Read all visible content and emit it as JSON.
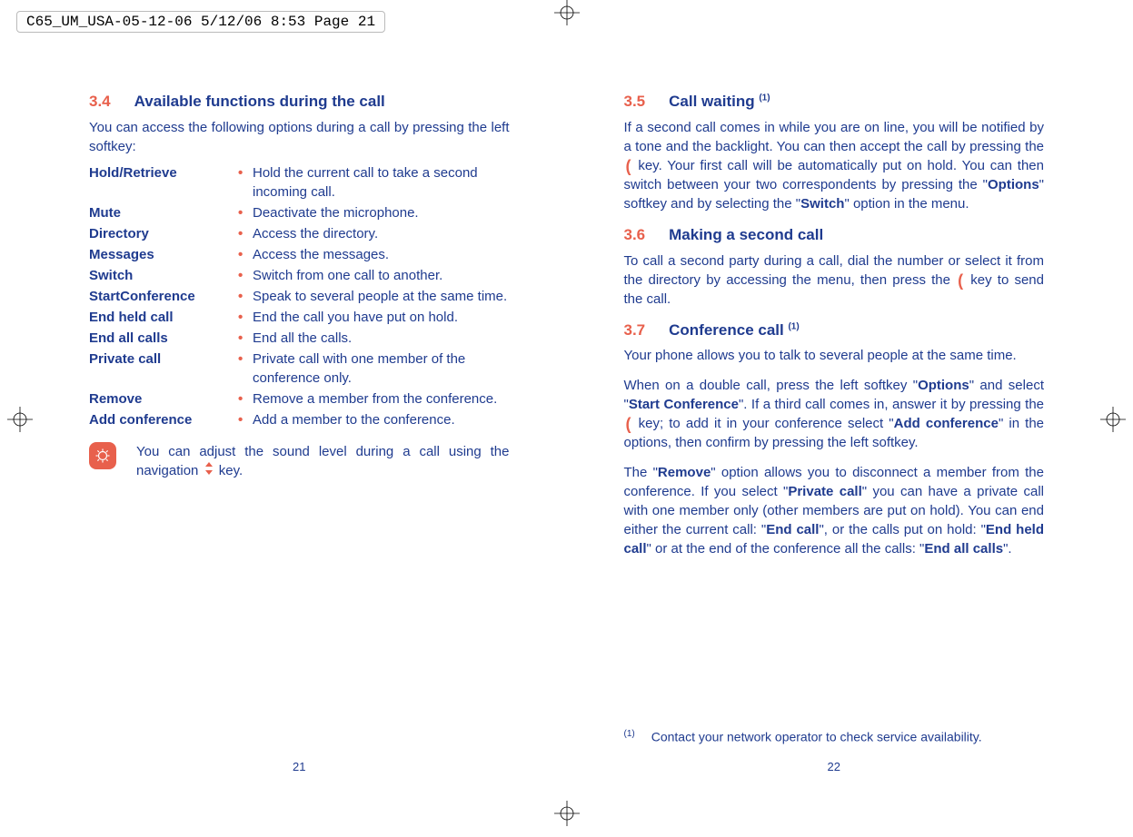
{
  "printHeader": "C65_UM_USA-05-12-06  5/12/06  8:53  Page 21",
  "leftPage": {
    "number": "21",
    "s34": {
      "num": "3.4",
      "title": "Available functions during the call",
      "intro": "You can access the following options during a call by pressing the left softkey:",
      "items": [
        {
          "name": "Hold/Retrieve",
          "desc": "Hold the current call to take a second incoming call."
        },
        {
          "name": "Mute",
          "desc": "Deactivate the microphone."
        },
        {
          "name": "Directory",
          "desc": "Access the directory."
        },
        {
          "name": "Messages",
          "desc": "Access the messages."
        },
        {
          "name": "Switch",
          "desc": "Switch from one call to another."
        },
        {
          "name": "StartConference",
          "desc": "Speak to several people at the same time."
        },
        {
          "name": "End held call",
          "desc": "End the call you have put on hold."
        },
        {
          "name": "End all calls",
          "desc": "End all the calls."
        },
        {
          "name": "Private call",
          "desc": "Private call with one member of the conference only."
        },
        {
          "name": "Remove",
          "desc": "Remove a member from the conference."
        },
        {
          "name": "Add conference",
          "desc": "Add a member to the conference."
        }
      ],
      "note_a": "You can adjust the sound level during a call using the navigation",
      "note_b": "key."
    }
  },
  "rightPage": {
    "number": "22",
    "s35": {
      "num": "3.5",
      "title": "Call waiting ",
      "sup": "(1)",
      "p1a": "If a second call comes in while you are on line, you will be notified by a tone and the backlight. You can then accept the call by pressing the ",
      "p1b": " key. Your first call will be automatically put on hold. You can then switch between your two correspondents by pressing the \"",
      "p1c": "Options",
      "p1d": "\" softkey and by selecting the \"",
      "p1e": "Switch",
      "p1f": "\" option in the menu."
    },
    "s36": {
      "num": "3.6",
      "title": "Making a second call",
      "p1a": "To call a second party during a call, dial the number or select it from the directory by accessing the menu, then press the ",
      "p1b": " key to send the call."
    },
    "s37": {
      "num": "3.7",
      "title": "Conference call ",
      "sup": "(1)",
      "p1": "Your phone allows you to talk to several people at the same time.",
      "p2a": "When on a double call, press the left softkey \"",
      "p2b": "Options",
      "p2c": "\" and select \"",
      "p2d": "Start Conference",
      "p2e": "\". If a third call comes in, answer it by pressing the ",
      "p2f": " key; to add it in your conference select \"",
      "p2g": "Add conference",
      "p2h": "\" in the options, then confirm by pressing the left softkey.",
      "p3a": "The \"",
      "p3b": "Remove",
      "p3c": "\" option allows you to disconnect a member from the conference. If you select \"",
      "p3d": "Private call",
      "p3e": "\" you can have a private call with one member only (other members are put on hold). You can end either the current call: \"",
      "p3f": "End call",
      "p3g": "\", or the calls put on hold: \"",
      "p3h": "End held call",
      "p3i": "\" or at the end of the conference all the calls: \"",
      "p3j": "End all calls",
      "p3k": "\"."
    },
    "footnote": "Contact your network operator to check service availability.",
    "footnoteSup": "(1)"
  }
}
